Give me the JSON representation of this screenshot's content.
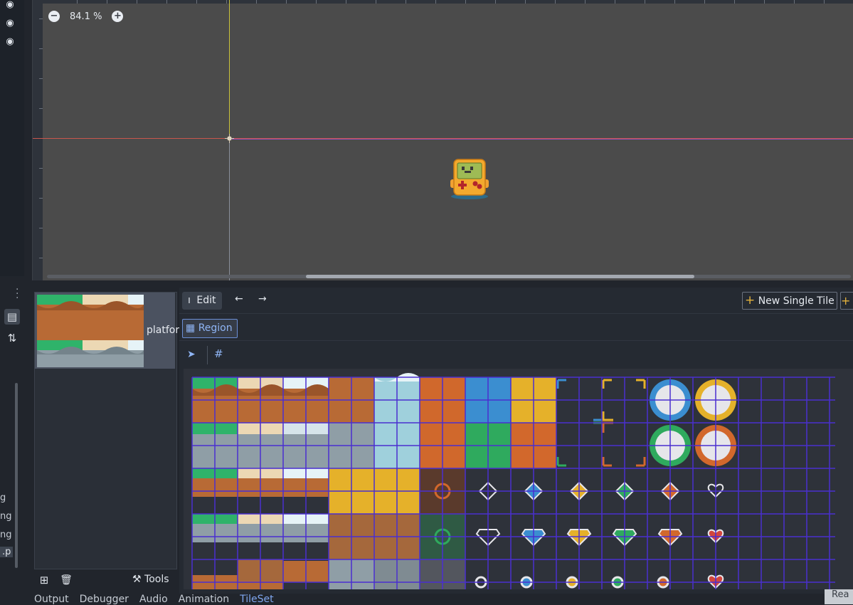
{
  "viewport": {
    "zoom_value": "84.1 %",
    "zoom_out_icon": "minus-circle-icon",
    "zoom_in_icon": "plus-circle-icon"
  },
  "left_strip": {
    "icons": [
      "eye-icon",
      "eye-icon",
      "eye-icon"
    ]
  },
  "side_cut_labels": [
    "g",
    "ng",
    "ng",
    ".p"
  ],
  "tileset_list": {
    "item_label": "platfor",
    "add_icon": "add-icon",
    "delete_icon": "trash-icon",
    "tools_label": "Tools"
  },
  "editor": {
    "edit_label": "Edit",
    "new_single_tile_label": "New Single Tile",
    "region_label": "Region",
    "colors": {
      "grid": "#4a2fd0",
      "accent": "#7fa6ee"
    }
  },
  "bottom_tabs": [
    {
      "label": "Output",
      "active": false
    },
    {
      "label": "Debugger",
      "active": false
    },
    {
      "label": "Audio",
      "active": false
    },
    {
      "label": "Animation",
      "active": false
    },
    {
      "label": "TileSet",
      "active": true
    }
  ],
  "corner_label": "Rea"
}
